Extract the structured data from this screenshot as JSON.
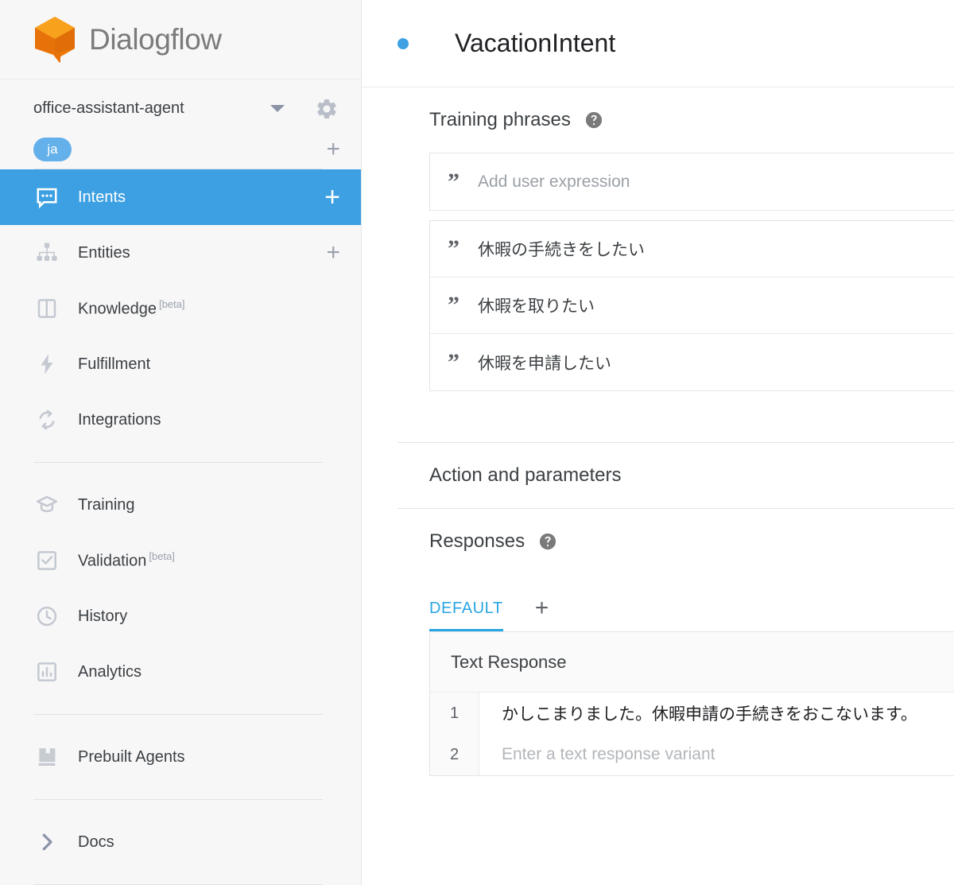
{
  "brand": {
    "name": "Dialogflow",
    "logo_icon": "dialogflow-cube-icon",
    "logo_color": "#ef7c00",
    "logo_color_light": "#f9a21b"
  },
  "colors": {
    "accent_blue": "#3da0e3",
    "tab_blue": "#29a5e3",
    "chip_blue": "#64b0ea",
    "sidebar_bg": "#f7f7f8",
    "icon_gray": "#c4c8d0",
    "text_dark": "#3c4043"
  },
  "sidebar": {
    "agent": {
      "name": "office-assistant-agent",
      "dropdown_icon": "chevron-down-icon",
      "settings_icon": "gear-icon"
    },
    "language": {
      "chip": "ja",
      "add_icon": "plus-icon"
    },
    "groups": [
      {
        "items": [
          {
            "label": "Intents",
            "icon": "chat-bubble-icon",
            "active": true,
            "badge": "",
            "has_add": true
          },
          {
            "label": "Entities",
            "icon": "hierarchy-icon",
            "active": false,
            "badge": "",
            "has_add": true
          },
          {
            "label": "Knowledge",
            "icon": "book-open-icon",
            "active": false,
            "badge": "[beta]",
            "has_add": false
          },
          {
            "label": "Fulfillment",
            "icon": "lightning-bolt-icon",
            "active": false,
            "badge": "",
            "has_add": false
          },
          {
            "label": "Integrations",
            "icon": "sync-arrows-icon",
            "active": false,
            "badge": "",
            "has_add": false
          }
        ]
      },
      {
        "items": [
          {
            "label": "Training",
            "icon": "graduation-cap-icon",
            "active": false,
            "badge": "",
            "has_add": false
          },
          {
            "label": "Validation",
            "icon": "checkbox-icon",
            "active": false,
            "badge": "[beta]",
            "has_add": false
          },
          {
            "label": "History",
            "icon": "clock-icon",
            "active": false,
            "badge": "",
            "has_add": false
          },
          {
            "label": "Analytics",
            "icon": "bar-chart-icon",
            "active": false,
            "badge": "",
            "has_add": false
          }
        ]
      },
      {
        "items": [
          {
            "label": "Prebuilt Agents",
            "icon": "bookmark-book-icon",
            "active": false,
            "badge": "",
            "has_add": false
          }
        ]
      },
      {
        "items": [
          {
            "label": "Docs",
            "icon": "chevron-right-icon",
            "active": false,
            "badge": "",
            "has_add": false
          }
        ]
      }
    ]
  },
  "header": {
    "status_dot": "status-dot-blue",
    "intent_name": "VacationIntent"
  },
  "training_phrases": {
    "section_title": "Training phrases",
    "help_icon": "help-circle-icon",
    "add_input_placeholder": "Add user expression",
    "quote_icon": "quote-mark-icon",
    "phrases": [
      "休暇の手続きをしたい",
      "休暇を取りたい",
      "休暇を申請したい"
    ]
  },
  "action_and_parameters": {
    "section_title": "Action and parameters"
  },
  "responses": {
    "section_title": "Responses",
    "help_icon": "help-circle-icon",
    "tabs": [
      {
        "label": "DEFAULT",
        "selected": true
      }
    ],
    "add_tab_icon": "plus-icon",
    "card_title": "Text Response",
    "lines": [
      {
        "num": "1",
        "text": "かしこまりました。休暇申請の手続きをおこないます。",
        "is_placeholder": false
      },
      {
        "num": "2",
        "text": "Enter a text response variant",
        "is_placeholder": true
      }
    ]
  }
}
